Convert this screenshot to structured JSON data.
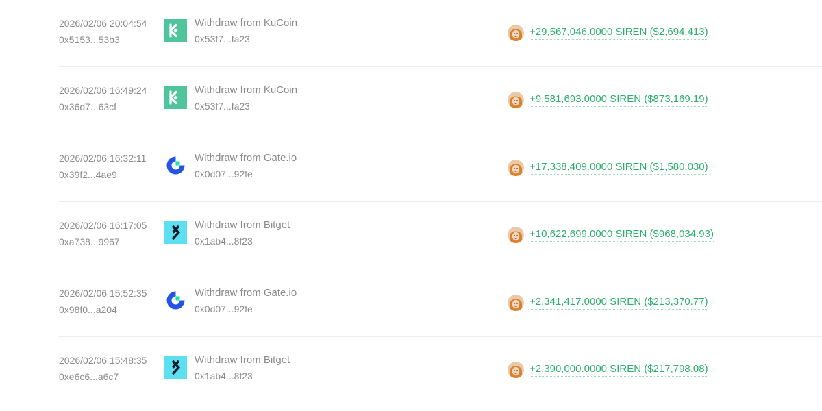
{
  "colors": {
    "text_muted": "#8a8a8a",
    "amount_green": "#2dae6e",
    "kucoin_green": "#4fc59b",
    "gate_blue": "#2354e6",
    "gate_green": "#17e6a1",
    "bitget_cyan": "#5cdff0"
  },
  "transactions": [
    {
      "timestamp": "2026/02/06 20:04:54",
      "tx_hash": "0x5153...53b3",
      "exchange_icon": "kucoin-icon",
      "description": "Withdraw from KuCoin",
      "from_address": "0x53f7...fa23",
      "token_icon": "siren-token-icon",
      "amount": "+29,567,046.0000 SIREN ($2,694,413)"
    },
    {
      "timestamp": "2026/02/06 16:49:24",
      "tx_hash": "0x36d7...63cf",
      "exchange_icon": "kucoin-icon",
      "description": "Withdraw from KuCoin",
      "from_address": "0x53f7...fa23",
      "token_icon": "siren-token-icon",
      "amount": "+9,581,693.0000 SIREN ($873,169.19)"
    },
    {
      "timestamp": "2026/02/06 16:32:11",
      "tx_hash": "0x39f2...4ae9",
      "exchange_icon": "gateio-icon",
      "description": "Withdraw from Gate.io",
      "from_address": "0x0d07...92fe",
      "token_icon": "siren-token-icon",
      "amount": "+17,338,409.0000 SIREN ($1,580,030)"
    },
    {
      "timestamp": "2026/02/06 16:17:05",
      "tx_hash": "0xa738...9967",
      "exchange_icon": "bitget-icon",
      "description": "Withdraw from Bitget",
      "from_address": "0x1ab4...8f23",
      "token_icon": "siren-token-icon",
      "amount": "+10,622,699.0000 SIREN ($968,034.93)"
    },
    {
      "timestamp": "2026/02/06 15:52:35",
      "tx_hash": "0x98f0...a204",
      "exchange_icon": "gateio-icon",
      "description": "Withdraw from Gate.io",
      "from_address": "0x0d07...92fe",
      "token_icon": "siren-token-icon",
      "amount": "+2,341,417.0000 SIREN ($213,370.77)"
    },
    {
      "timestamp": "2026/02/06 15:48:35",
      "tx_hash": "0xe6c6...a6c7",
      "exchange_icon": "bitget-icon",
      "description": "Withdraw from Bitget",
      "from_address": "0x1ab4...8f23",
      "token_icon": "siren-token-icon",
      "amount": "+2,390,000.0000 SIREN ($217,798.08)"
    }
  ]
}
